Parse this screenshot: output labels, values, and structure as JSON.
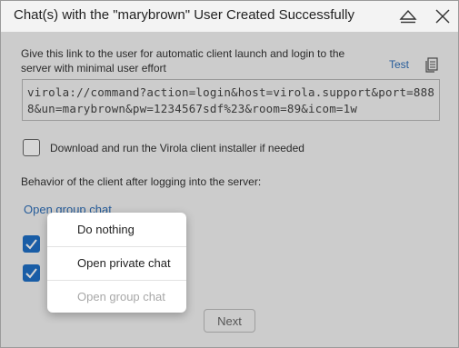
{
  "window": {
    "title": "Chat(s) with the \"marybrown\" User Created Successfully"
  },
  "titlebar": {
    "minimize_icon": "triangle-up-icon",
    "close_icon": "close-icon"
  },
  "link_section": {
    "description": "Give this link to the user for automatic client launch and login to the server with minimal user effort",
    "test_label": "Test",
    "copy_icon": "copy-icon",
    "url": "virola://command?action=login&host=virola.support&port=8888&un=marybrown&pw=1234567sdf%23&room=89&icom=1w"
  },
  "installer_option": {
    "label": "Download and run the Virola client installer if needed",
    "checked": false
  },
  "behavior": {
    "label": "Behavior of the client after logging into the server:",
    "selected": "Open group chat",
    "options": [
      {
        "label": "Do nothing",
        "enabled": true
      },
      {
        "label": "Open private chat",
        "enabled": true
      },
      {
        "label": "Open group chat",
        "enabled": false
      }
    ]
  },
  "buttons": {
    "next": "Next"
  },
  "colors": {
    "accent": "#1e6fc6",
    "link": "#2f6fb8",
    "background": "#f3f3f3"
  }
}
